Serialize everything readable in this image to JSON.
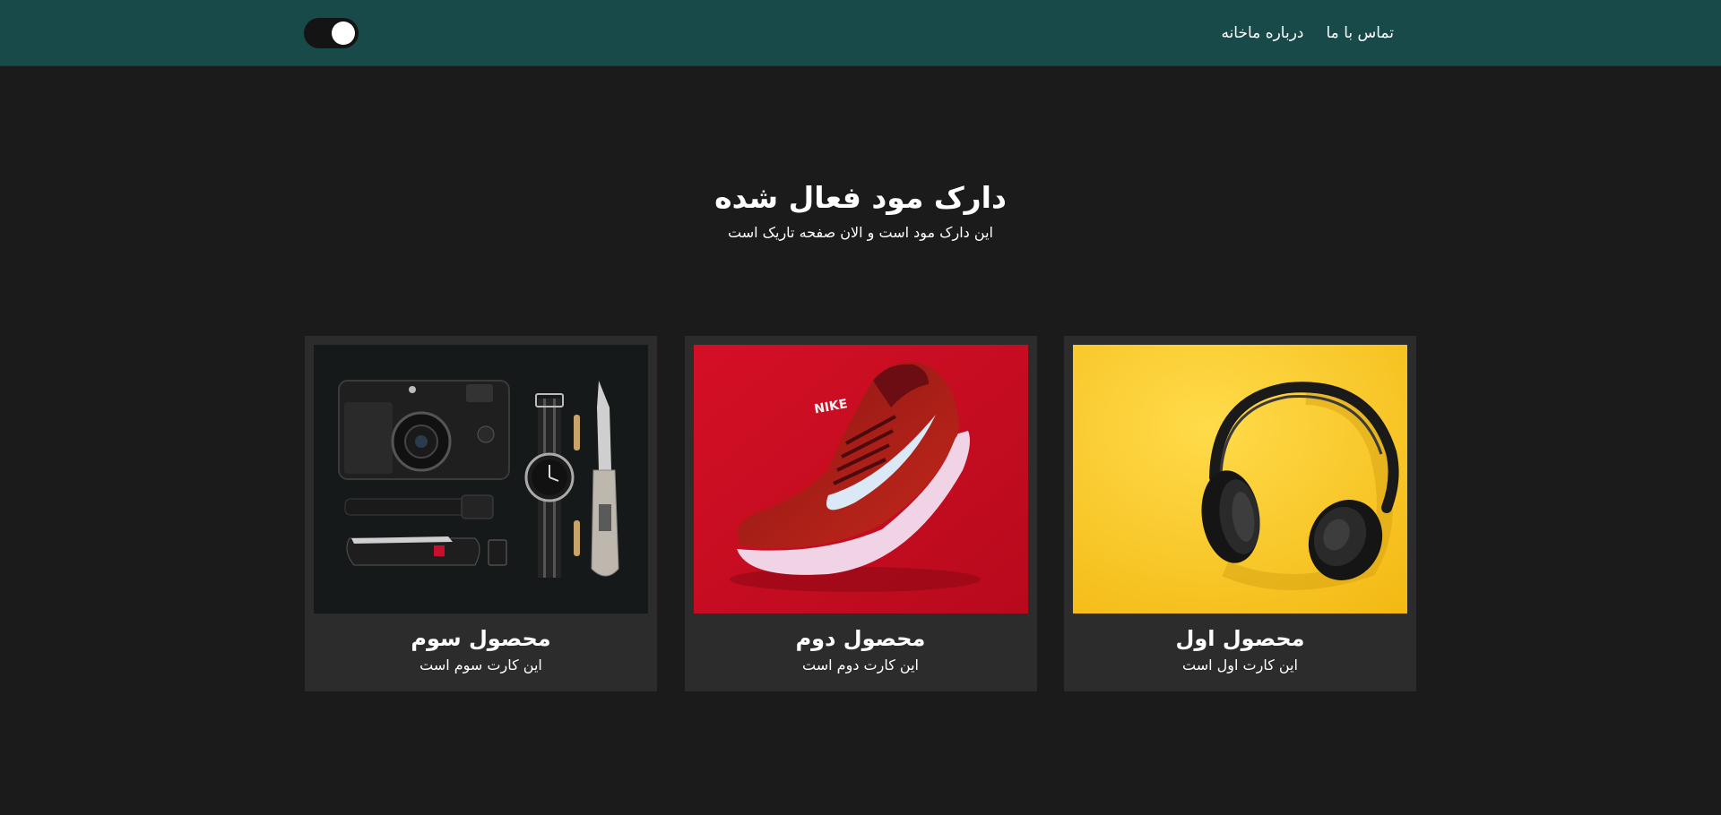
{
  "navbar": {
    "background": "#184a4a",
    "links": [
      {
        "label": "خانه"
      },
      {
        "label": "درباره ما"
      },
      {
        "label": "تماس با ما"
      }
    ],
    "dark_mode_toggle": {
      "state": "on"
    }
  },
  "hero": {
    "title": "دارک مود فعال شده",
    "subtitle": "این دارک مود است و الان صفحه تاریک است"
  },
  "cards": [
    {
      "title": "محصول سوم",
      "text": "این کارت سوم است",
      "image": "camera-kit-photo"
    },
    {
      "title": "محصول دوم",
      "text": "این کارت دوم است",
      "image": "red-sneaker-photo"
    },
    {
      "title": "محصول اول",
      "text": "این کارت اول است",
      "image": "headphones-photo"
    }
  ],
  "colors": {
    "page_background": "#1b1b1b",
    "card_background": "#2c2c2c",
    "text": "#ffffff"
  }
}
